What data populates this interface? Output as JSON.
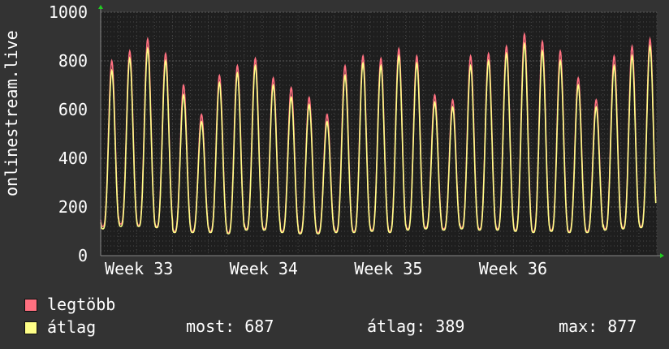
{
  "colors": {
    "background": "#333333",
    "plot_background": "#1e1e1e",
    "grid": "#4a4a4a",
    "max_series": "#ff7080",
    "avg_series": "#ffff88",
    "axis_arrow": "#22cc22"
  },
  "legend": {
    "max_label": "legtöbb",
    "avg_label": "átlag"
  },
  "stats": {
    "current": "most: 687",
    "average": "átlag: 389",
    "maximum": "max: 877"
  },
  "chart_data": {
    "type": "line",
    "title": "",
    "ylabel": "onlinestream.live",
    "xlabel": "",
    "ylim": [
      0,
      1000
    ],
    "yticks": [
      0,
      200,
      400,
      600,
      800,
      1000
    ],
    "x_tick_labels": [
      "Week 33",
      "Week 34",
      "Week 35",
      "Week 36"
    ],
    "grid": true,
    "legend_position": "bottom-left",
    "x_unit": "day",
    "x": [
      1,
      2,
      3,
      4,
      5,
      6,
      7,
      8,
      9,
      10,
      11,
      12,
      13,
      14,
      15,
      16,
      17,
      18,
      19,
      20,
      21,
      22,
      23,
      24,
      25,
      26,
      27,
      28,
      29,
      30,
      31
    ],
    "series": [
      {
        "name": "legtöbb",
        "daily_peak": [
          800,
          840,
          890,
          830,
          700,
          580,
          740,
          780,
          810,
          730,
          690,
          650,
          580,
          780,
          820,
          810,
          850,
          820,
          660,
          640,
          820,
          830,
          860,
          910,
          880,
          840,
          730,
          640,
          820,
          860,
          890
        ],
        "daily_trough": [
          120,
          130,
          125,
          120,
          100,
          100,
          100,
          95,
          110,
          110,
          100,
          95,
          95,
          100,
          100,
          105,
          100,
          110,
          115,
          110,
          115,
          110,
          110,
          105,
          100,
          105,
          100,
          100,
          110,
          115,
          120
        ]
      },
      {
        "name": "átlag",
        "daily_peak": [
          760,
          810,
          850,
          800,
          660,
          550,
          710,
          750,
          780,
          700,
          650,
          620,
          550,
          740,
          790,
          780,
          820,
          790,
          630,
          610,
          780,
          800,
          830,
          870,
          840,
          800,
          700,
          610,
          780,
          820,
          860
        ],
        "daily_trough": [
          110,
          120,
          120,
          115,
          95,
          95,
          95,
          90,
          105,
          105,
          95,
          90,
          90,
          95,
          95,
          100,
          95,
          105,
          110,
          105,
          110,
          105,
          105,
          100,
          95,
          100,
          95,
          95,
          105,
          110,
          115
        ]
      }
    ]
  }
}
